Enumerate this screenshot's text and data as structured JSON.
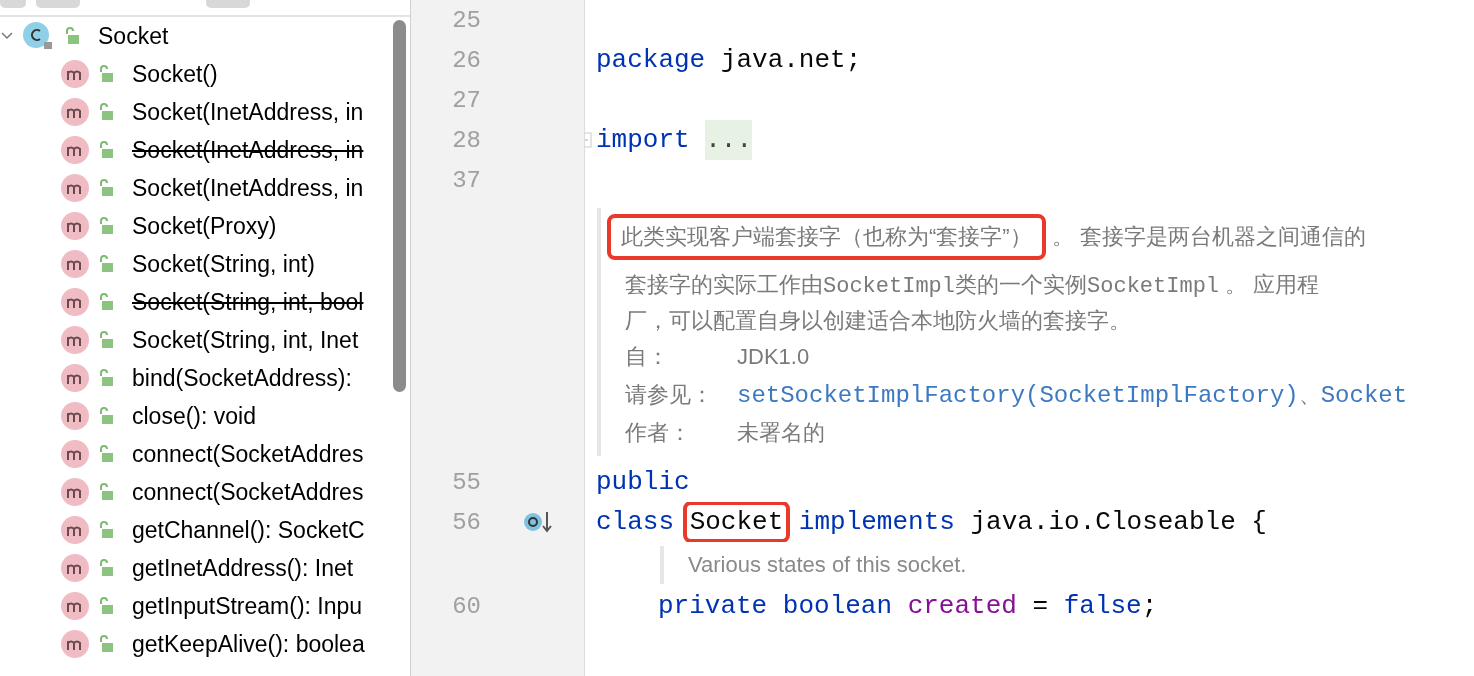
{
  "structure": {
    "root": {
      "label": "Socket",
      "kind": "class",
      "expanded": true,
      "children": [
        {
          "label": "Socket()",
          "deprecated": false
        },
        {
          "label": "Socket(InetAddress, in",
          "deprecated": false
        },
        {
          "label": "Socket(InetAddress, in",
          "deprecated": true
        },
        {
          "label": "Socket(InetAddress, in",
          "deprecated": false
        },
        {
          "label": "Socket(Proxy)",
          "deprecated": false
        },
        {
          "label": "Socket(String, int)",
          "deprecated": false
        },
        {
          "label": "Socket(String, int, bool",
          "deprecated": true
        },
        {
          "label": "Socket(String, int, Inet",
          "deprecated": false
        },
        {
          "label": "bind(SocketAddress):",
          "deprecated": false
        },
        {
          "label": "close(): void",
          "deprecated": false
        },
        {
          "label": "connect(SocketAddres",
          "deprecated": false
        },
        {
          "label": "connect(SocketAddres",
          "deprecated": false
        },
        {
          "label": "getChannel(): SocketC",
          "deprecated": false
        },
        {
          "label": "getInetAddress(): Inet",
          "deprecated": false
        },
        {
          "label": "getInputStream(): Inpu",
          "deprecated": false
        },
        {
          "label": "getKeepAlive(): boolea",
          "deprecated": false
        }
      ]
    }
  },
  "editor": {
    "lines": [
      {
        "kind": "code",
        "number": "25"
      },
      {
        "kind": "code",
        "number": "26",
        "tokens": [
          {
            "text": "package",
            "kind": "keyword"
          },
          {
            "text": "java.net;",
            "kind": "plain"
          }
        ]
      },
      {
        "kind": "code",
        "number": "27"
      },
      {
        "kind": "code",
        "number": "28",
        "folded": true,
        "tokens": [
          {
            "text": "import",
            "kind": "keyword"
          },
          {
            "text": "...",
            "kind": "fold"
          }
        ]
      },
      {
        "kind": "code",
        "number": "37"
      },
      {
        "kind": "doc",
        "paragraphs": [
          [
            {
              "text": "此类实现客户端套接字（也称为“套接字”）",
              "kind": "boxed"
            },
            {
              "text": "。 套接字是两台机器之间通信的",
              "kind": "text"
            }
          ],
          [
            {
              "text": "套接字的实际工作由",
              "kind": "text"
            },
            {
              "text": "SocketImpl",
              "kind": "code"
            },
            {
              "text": "类的一个实例",
              "kind": "text"
            },
            {
              "text": "SocketImpl",
              "kind": "code"
            },
            {
              "text": " 。 应用程",
              "kind": "text"
            }
          ],
          [
            {
              "text": "厂，可以配置自身以创建适合本地防火墙的套接字。",
              "kind": "text"
            }
          ]
        ],
        "tags": [
          {
            "label": "自：",
            "values": [
              {
                "text": "JDK1.0",
                "kind": "text"
              }
            ]
          },
          {
            "label": "请参见：",
            "values": [
              {
                "text": "setSocketImplFactory(SocketImplFactory)",
                "kind": "link"
              },
              {
                "text": " 、 ",
                "kind": "text"
              },
              {
                "text": "Socket",
                "kind": "link"
              }
            ]
          },
          {
            "label": "作者：",
            "values": [
              {
                "text": "未署名的",
                "kind": "text"
              }
            ]
          }
        ]
      },
      {
        "kind": "code",
        "number": "55",
        "tokens": [
          {
            "text": "public",
            "kind": "keyword"
          }
        ]
      },
      {
        "kind": "code",
        "number": "56",
        "marker": true,
        "tokens": [
          {
            "text": "class",
            "kind": "keyword"
          },
          {
            "text": "Socket",
            "kind": "boxed"
          },
          {
            "text": "implements",
            "kind": "keyword"
          },
          {
            "text": "java.io.Closeable {",
            "kind": "plain"
          }
        ]
      },
      {
        "kind": "note",
        "text": "Various states of this socket."
      },
      {
        "kind": "code",
        "number": "60",
        "indented": true,
        "tokens": [
          {
            "text": "private",
            "kind": "keyword"
          },
          {
            "text": "boolean",
            "kind": "keyword"
          },
          {
            "text": "created",
            "kind": "field"
          },
          {
            "text": "=",
            "kind": "plain"
          },
          {
            "text": "false",
            "kind": "keyword"
          },
          {
            "text": ";",
            "kind": "plain",
            "attached": true
          }
        ]
      }
    ]
  }
}
